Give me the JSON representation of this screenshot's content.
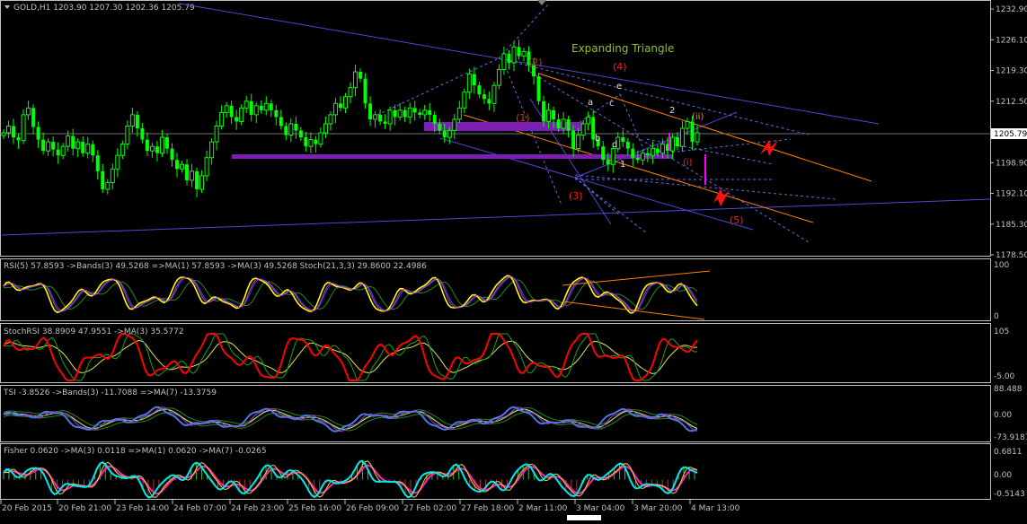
{
  "colors": {
    "background": "#000000",
    "frame": "#c0c0c0",
    "candle_up": "#00ff00",
    "candle_down": "#00ff00",
    "blue_line": "#4a4ad8",
    "orange_line": "#ff8000",
    "purple": "#7a1fb0",
    "magenta": "#ff00ff",
    "label_red": "#ff2020",
    "label_white": "#e0e0e0",
    "title_green": "#90c030",
    "rsi": "#ffff00",
    "stoch_red": "#ff0000",
    "tsi": "#4a7ae8",
    "fisher_cyan": "#00e8f0",
    "fisher_magenta": "#ff20c0",
    "price_box_bg": "#ffffff"
  },
  "main": {
    "header": "GOLD,H1  1203.90 1207.30 1202.36 1205.79",
    "annotation_title": "Expanding Triangle",
    "price_ticks": [
      "1232.90",
      "1226.10",
      "1219.30",
      "1212.50",
      "1205.79",
      "1198.90",
      "1192.10",
      "1185.30",
      "1178.50"
    ],
    "current_price": "1205.79",
    "wave_labels_red": [
      "(1)",
      "(2)",
      "(3)",
      "(4)",
      "(5)",
      "(i)",
      "(ii)"
    ],
    "wave_labels_white": [
      "a",
      "b",
      "c",
      "d",
      "e",
      "1",
      "2"
    ]
  },
  "indicators": [
    {
      "header": "RSI(5) 57.8593  ->Bands(3) 49.5268  =>MA(1) 57.8593  ->MA(3) 49.5268  Stoch(21,3,3) 29.8600 22.4986",
      "scale": [
        "100",
        "0"
      ]
    },
    {
      "header": "StochRSI 38.8909 47.9551  ->MA(3) 35.5772",
      "scale": [
        "105",
        "-5.00"
      ]
    },
    {
      "header": "TSI -3.8526  ->Bands(3) -11.7088  =>MA(7) -13.3759",
      "scale": [
        "88.488",
        "0.00",
        "-73.9187"
      ]
    },
    {
      "header": "Fisher 0.0620  ->MA(3) 0.0118  =>MA(1) 0.0620  ->MA(7) -0.0265",
      "scale": [
        "0.6811",
        "0.00",
        "-0.5143"
      ]
    }
  ],
  "time_axis": [
    "20 Feb 2015",
    "20 Feb 21:00",
    "23 Feb 14:00",
    "24 Feb 07:00",
    "24 Feb 23:00",
    "25 Feb 16:00",
    "26 Feb 09:00",
    "27 Feb 02:00",
    "27 Feb 18:00",
    "2 Mar 11:00",
    "3 Mar 04:00",
    "3 Mar 20:00",
    "4 Mar 13:00"
  ],
  "chart_data": {
    "type": "candlestick",
    "symbol": "GOLD",
    "timeframe": "H1",
    "last_bar": {
      "open": 1203.9,
      "high": 1207.3,
      "low": 1202.36,
      "close": 1205.79
    },
    "ylim": [
      1178.5,
      1234.5
    ],
    "closes": [
      1205.5,
      1207.0,
      1204.5,
      1203.8,
      1209.5,
      1211.0,
      1206.8,
      1204.0,
      1201.5,
      1203.5,
      1201.8,
      1200.5,
      1202.5,
      1204.8,
      1202.0,
      1203.5,
      1201.0,
      1203.0,
      1200.5,
      1197.0,
      1193.0,
      1194.5,
      1197.5,
      1200.5,
      1203.0,
      1207.0,
      1209.5,
      1206.5,
      1204.0,
      1201.5,
      1202.5,
      1201.0,
      1204.5,
      1202.0,
      1199.5,
      1197.5,
      1198.5,
      1195.0,
      1197.0,
      1193.0,
      1196.0,
      1200.0,
      1203.5,
      1207.0,
      1210.0,
      1211.5,
      1209.0,
      1208.0,
      1211.0,
      1212.5,
      1209.5,
      1211.5,
      1210.5,
      1212.0,
      1210.5,
      1209.0,
      1207.0,
      1205.0,
      1207.5,
      1206.0,
      1204.5,
      1202.5,
      1204.0,
      1203.0,
      1205.5,
      1207.5,
      1209.5,
      1212.0,
      1211.0,
      1213.5,
      1215.5,
      1219.0,
      1217.5,
      1212.0,
      1208.5,
      1209.5,
      1208.0,
      1207.5,
      1210.5,
      1209.0,
      1210.5,
      1209.0,
      1211.0,
      1210.0,
      1209.5,
      1210.5,
      1209.5,
      1207.5,
      1206.0,
      1204.5,
      1206.0,
      1208.5,
      1211.0,
      1214.5,
      1218.5,
      1216.0,
      1214.0,
      1213.0,
      1212.0,
      1216.0,
      1219.5,
      1223.0,
      1221.0,
      1224.5,
      1222.5,
      1223.5,
      1220.5,
      1218.0,
      1212.5,
      1208.0,
      1210.5,
      1208.5,
      1206.5,
      1208.5,
      1206.0,
      1202.0,
      1205.0,
      1207.5,
      1209.0,
      1204.0,
      1202.5,
      1199.5,
      1198.5,
      1202.0,
      1204.5,
      1203.5,
      1202.0,
      1200.0,
      1199.5,
      1201.0,
      1200.5,
      1202.0,
      1201.0,
      1203.0,
      1201.5,
      1204.5,
      1202.5,
      1206.5,
      1208.0,
      1203.5,
      1205.5
    ],
    "indicators": [
      {
        "name": "RSI(5)",
        "value": 57.8593,
        "bands": 49.5268,
        "ma1": 57.8593,
        "ma3": 49.5268,
        "stoch": [
          29.86,
          22.4986
        ],
        "ylim": [
          0,
          100
        ]
      },
      {
        "name": "StochRSI",
        "values": [
          38.8909,
          47.9551
        ],
        "ma3": 35.5772,
        "ylim": [
          -5,
          105
        ]
      },
      {
        "name": "TSI",
        "value": -3.8526,
        "bands": -11.7088,
        "ma7": -13.3759,
        "ylim": [
          -73.9187,
          88.488
        ]
      },
      {
        "name": "Fisher",
        "value": 0.062,
        "ma3": 0.0118,
        "ma1": 0.062,
        "ma7": -0.0265,
        "ylim": [
          -0.5143,
          0.6811
        ]
      }
    ]
  }
}
